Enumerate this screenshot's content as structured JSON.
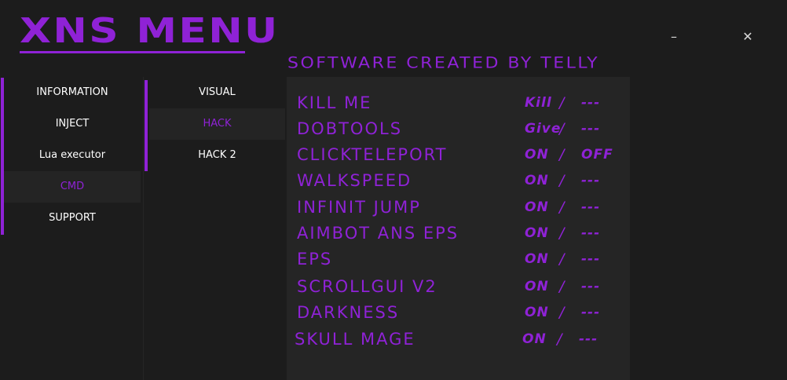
{
  "app": {
    "logo": "XNS MENU",
    "subtitle": "SOFTWARE CREATED BY TELLY",
    "minimize_label": "–",
    "close_label": "✕",
    "accent_color": "#8f22d6"
  },
  "sidebar": {
    "items": [
      {
        "label": "INFORMATION",
        "active": false
      },
      {
        "label": "INJECT",
        "active": false
      },
      {
        "label": "Lua executor",
        "active": false
      },
      {
        "label": "CMD",
        "active": true
      },
      {
        "label": "SUPPORT",
        "active": false
      }
    ]
  },
  "subnav": {
    "items": [
      {
        "label": "VISUAL",
        "active": false
      },
      {
        "label": "HACK",
        "active": true
      },
      {
        "label": "HACK 2",
        "active": false
      }
    ]
  },
  "features": [
    {
      "name": "KILL ME",
      "on": "Kill",
      "sep": "/",
      "off": "---"
    },
    {
      "name": "DOBTOOLS",
      "on": "Give",
      "sep": "/",
      "off": "---"
    },
    {
      "name": "CLICKTELEPORT",
      "on": "ON",
      "sep": "/",
      "off": "OFF"
    },
    {
      "name": "WALKSPEED",
      "on": "ON",
      "sep": "/",
      "off": "---"
    },
    {
      "name": "INFINIT JUMP",
      "on": "ON",
      "sep": "/",
      "off": "---"
    },
    {
      "name": "AIMBOT ANS EPS",
      "on": "ON",
      "sep": "/",
      "off": "---"
    },
    {
      "name": "EPS",
      "on": "ON",
      "sep": "/",
      "off": "---"
    },
    {
      "name": "SCROLLGUI V2",
      "on": "ON",
      "sep": "/",
      "off": "---"
    },
    {
      "name": "DARKNESS",
      "on": "ON",
      "sep": "/",
      "off": "---"
    },
    {
      "name": "SKULL MAGE",
      "on": "ON",
      "sep": "/",
      "off": "---"
    }
  ]
}
